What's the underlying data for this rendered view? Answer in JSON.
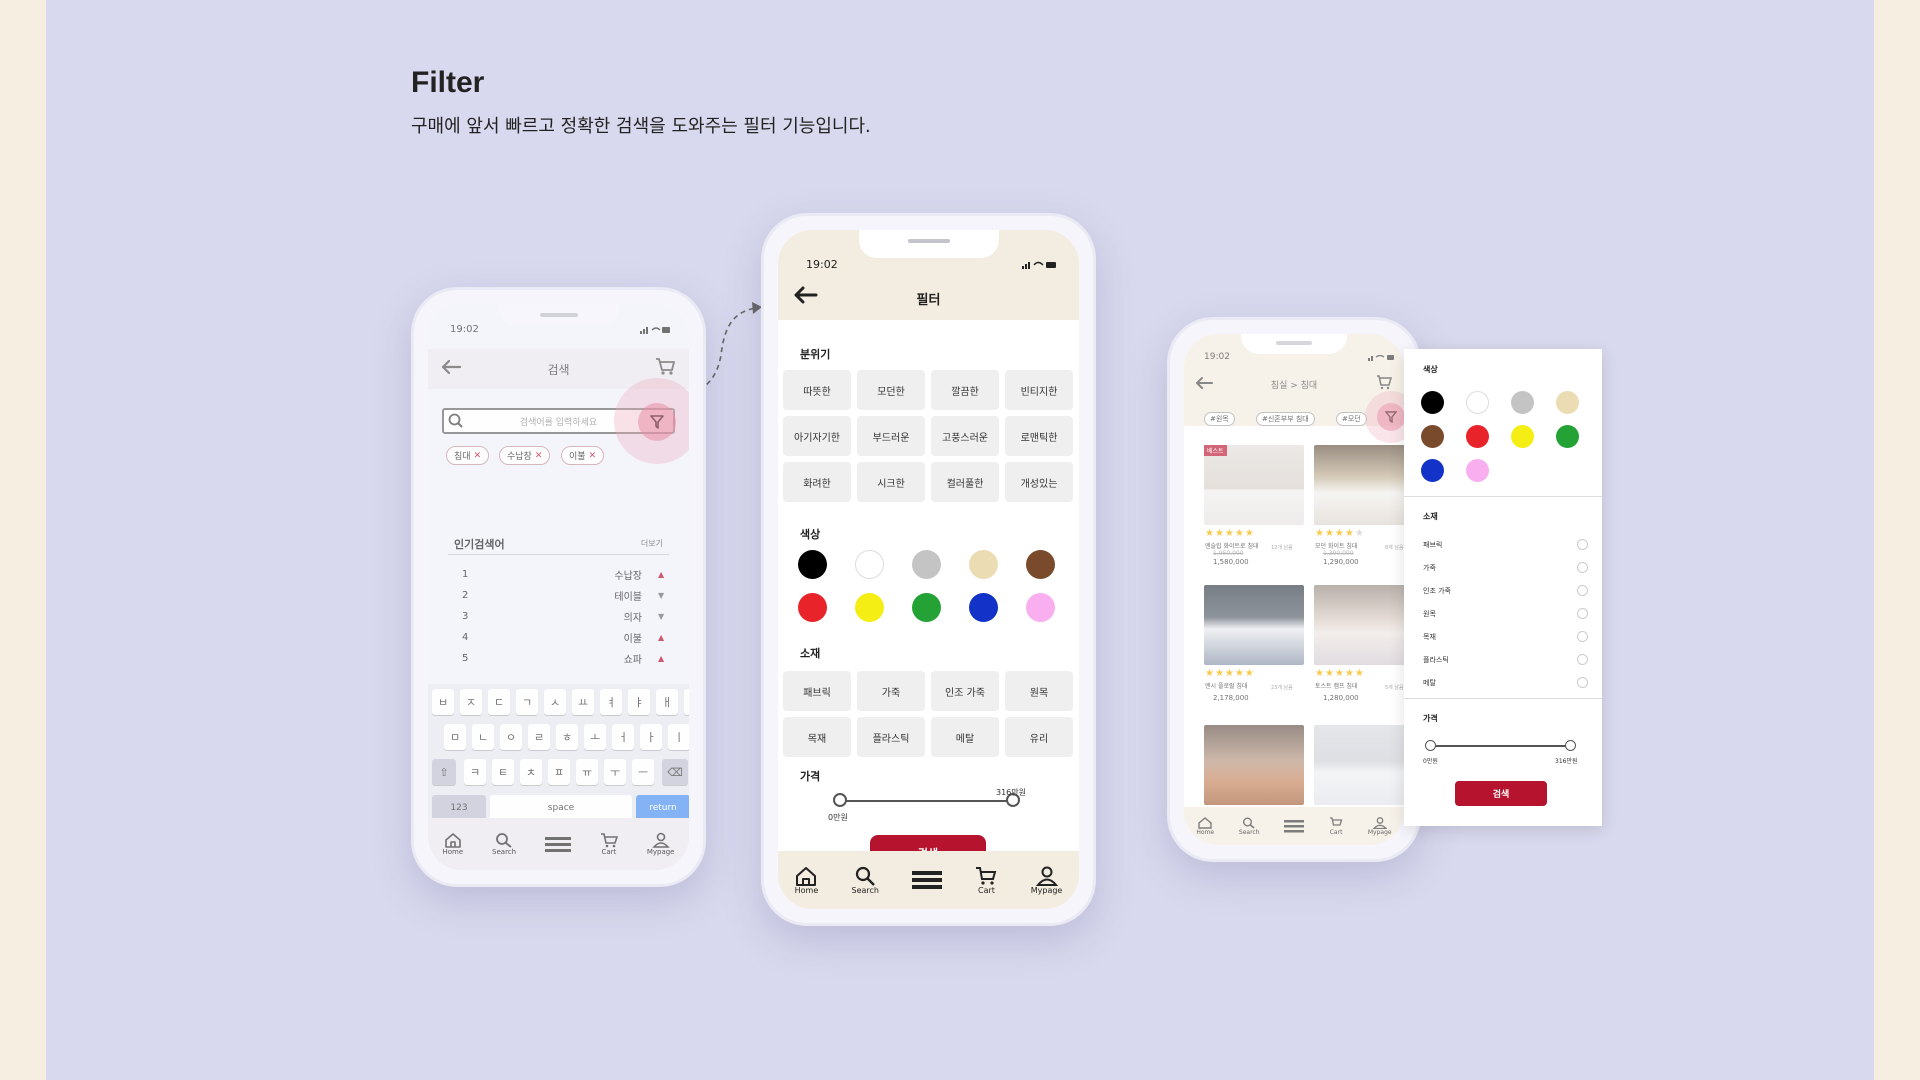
{
  "heading": {
    "title": "Filter",
    "subtitle": "구매에 앞서 빠르고 정확한 검색을 도와주는 필터 기능입니다."
  },
  "colors": {
    "canvas": "#d8d8ee",
    "accent": "#b5132e",
    "header_beige": "#f3ece0"
  },
  "status_time": "19:02",
  "search_screen": {
    "title": "검색",
    "search_placeholder": "검색어를 입력하세요",
    "tags": [
      "침대",
      "수납장",
      "이불"
    ],
    "popular_title": "인기검색어",
    "more_label": "더보기",
    "popular": [
      {
        "rank": "1",
        "term": "수납장",
        "trend": "up"
      },
      {
        "rank": "2",
        "term": "테이블",
        "trend": "down"
      },
      {
        "rank": "3",
        "term": "의자",
        "trend": "down"
      },
      {
        "rank": "4",
        "term": "이불",
        "trend": "up"
      },
      {
        "rank": "5",
        "term": "쇼파",
        "trend": "up"
      }
    ],
    "keyboard": {
      "row1": [
        "ㅂ",
        "ㅈ",
        "ㄷ",
        "ㄱ",
        "ㅅ",
        "ㅛ",
        "ㅕ",
        "ㅑ",
        "ㅐ",
        "ㅔ"
      ],
      "row2": [
        "ㅁ",
        "ㄴ",
        "ㅇ",
        "ㄹ",
        "ㅎ",
        "ㅗ",
        "ㅓ",
        "ㅏ",
        "ㅣ"
      ],
      "row3": [
        "ㅋ",
        "ㅌ",
        "ㅊ",
        "ㅍ",
        "ㅠ",
        "ㅜ",
        "ㅡ"
      ],
      "num_key": "123",
      "space_key": "space",
      "return_key": "return"
    }
  },
  "filter_screen": {
    "title": "필터",
    "mood_label": "분위기",
    "moods": [
      "따뜻한",
      "모던한",
      "깔끔한",
      "빈티지한",
      "아기자기한",
      "부드러운",
      "고풍스러운",
      "로맨틱한",
      "화려한",
      "시크한",
      "컬러풀한",
      "개성있는"
    ],
    "color_label": "색상",
    "swatches": [
      "#000000",
      "#ffffff",
      "#c4c4c4",
      "#ecdcb4",
      "#7a4a2c",
      "#e8232a",
      "#f5ee14",
      "#24a236",
      "#1232c8",
      "#f9aef0"
    ],
    "material_label": "소재",
    "materials": [
      "패브릭",
      "가죽",
      "인조 가죽",
      "원목",
      "목재",
      "플라스틱",
      "메탈",
      "유리"
    ],
    "price_label": "가격",
    "price_min": "0만원",
    "price_max": "316만원",
    "search_button": "검색"
  },
  "tabbar": [
    "Home",
    "Search",
    "",
    "Cart",
    "Mypage"
  ],
  "product_screen": {
    "breadcrumb": "침실 > 침대",
    "tags": [
      "#원목",
      "#신혼부부 침대",
      "#모던"
    ],
    "badge": "베스트",
    "products": [
      {
        "name": "엔슬립 화이트로 침대",
        "old": "1,950,000",
        "price": "1,580,000",
        "reviews": "12개 남음",
        "rating": 5
      },
      {
        "name": "모던 화이트 침대",
        "old": "1,390,000",
        "price": "1,290,000",
        "reviews": "8개 남음",
        "rating": 4
      },
      {
        "name": "엔시 플로럴 침대",
        "old": "",
        "price": "2,178,000",
        "reviews": "23개 남음",
        "rating": 5
      },
      {
        "name": "토스트 캠프 침대",
        "old": "",
        "price": "1,280,000",
        "reviews": "5개 남음",
        "rating": 5
      },
      {
        "name": "",
        "old": "",
        "price": "",
        "reviews": "",
        "rating": 3
      },
      {
        "name": "",
        "old": "",
        "price": "",
        "reviews": "",
        "rating": 4
      }
    ]
  },
  "side_panel": {
    "color_label": "색상",
    "swatches": [
      "#000000",
      "#ffffff",
      "#c4c4c4",
      "#ecdcb4",
      "#7a4a2c",
      "#e8232a",
      "#f5ee14",
      "#24a236",
      "#1232c8",
      "#f9aef0"
    ],
    "material_label": "소재",
    "materials": [
      "패브릭",
      "가죽",
      "인조 가죽",
      "원목",
      "목재",
      "플라스틱",
      "메탈"
    ],
    "price_label": "가격",
    "price_min": "0만원",
    "price_max": "316만원",
    "search_button": "검색"
  }
}
